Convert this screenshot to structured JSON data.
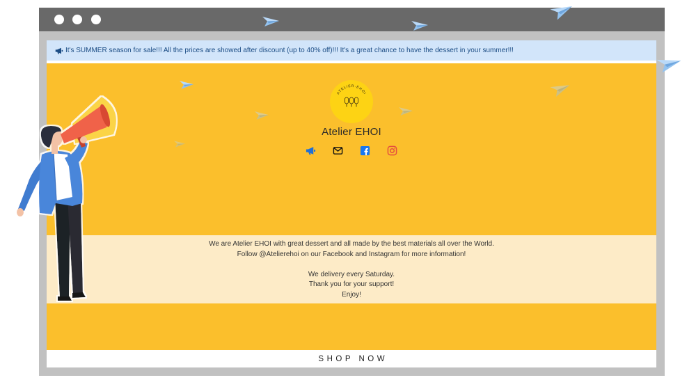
{
  "colors": {
    "frame_bar": "#696969",
    "frame": "#c1c1c1",
    "announcement_bg": "#d2e5fa",
    "announcement_text": "#1b4c84",
    "primary_yellow": "#fbbf2c",
    "cream": "#fdebc7",
    "logo_yellow": "#fdd314"
  },
  "announcement": {
    "icon": "megaphone-icon",
    "text": "It's SUMMER season for sale!!! All the prices are showed after discount (up to 40% off)!!! It's a great chance to have the dessert in your summer!!!"
  },
  "brand": {
    "logo_text": "ATELIER·EHOI",
    "name": "Atelier EHOI"
  },
  "social": [
    {
      "icon": "megaphone-icon",
      "color": "#1f6fd6"
    },
    {
      "icon": "envelope-icon",
      "color": "#111111"
    },
    {
      "icon": "facebook-icon",
      "color": "#1877f2"
    },
    {
      "icon": "instagram-icon",
      "color": "#e4503f"
    }
  ],
  "about": {
    "paragraphs": [
      [
        "We are Atelier EHOI with great dessert and all made by the best materials all over the World.",
        "Follow @Atelierehoi on our Facebook and Instagram for more information!"
      ],
      [
        "We delivery every Saturday.",
        "Thank you for your support!",
        "Enjoy!"
      ]
    ]
  },
  "cta": {
    "label": "SHOP NOW"
  }
}
